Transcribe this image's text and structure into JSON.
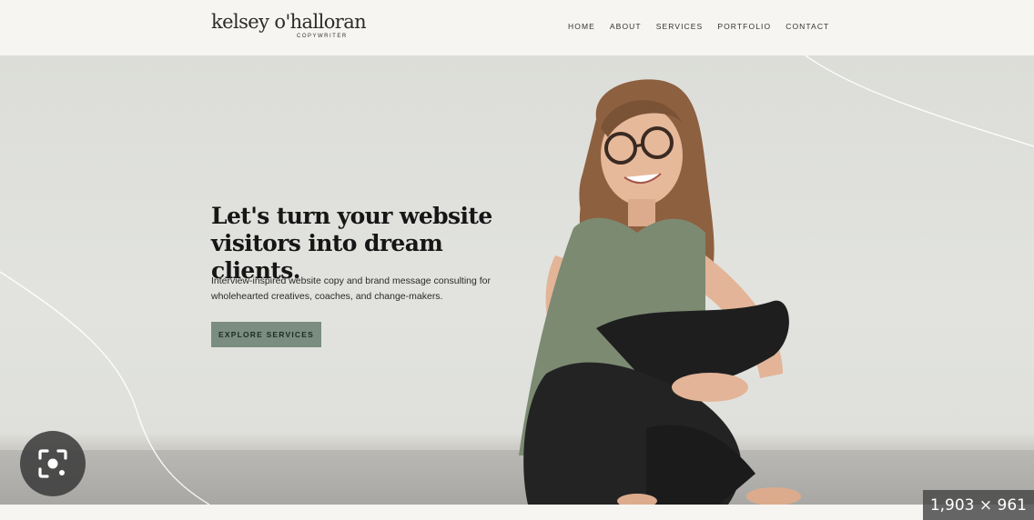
{
  "header": {
    "brand_name": "kelsey o'halloran",
    "brand_sub": "COPYWRITER",
    "nav": [
      "HOME",
      "ABOUT",
      "SERVICES",
      "PORTFOLIO",
      "CONTACT"
    ]
  },
  "hero": {
    "headline_line1": "Let's turn your website",
    "headline_line2": "visitors into dream clients.",
    "subtext_line1": "Interview-inspired website copy and brand message consulting for",
    "subtext_line2": "wholehearted creatives, coaches, and change-makers.",
    "cta_label": "EXPLORE SERVICES"
  },
  "overlay": {
    "lens_icon": "visual-search-icon",
    "dimensions": "1,903 × 961"
  },
  "colors": {
    "page_bg": "#f7f5f2",
    "hero_bg": "#dcddd8",
    "accent": "#7a8d80",
    "text": "#161616"
  }
}
